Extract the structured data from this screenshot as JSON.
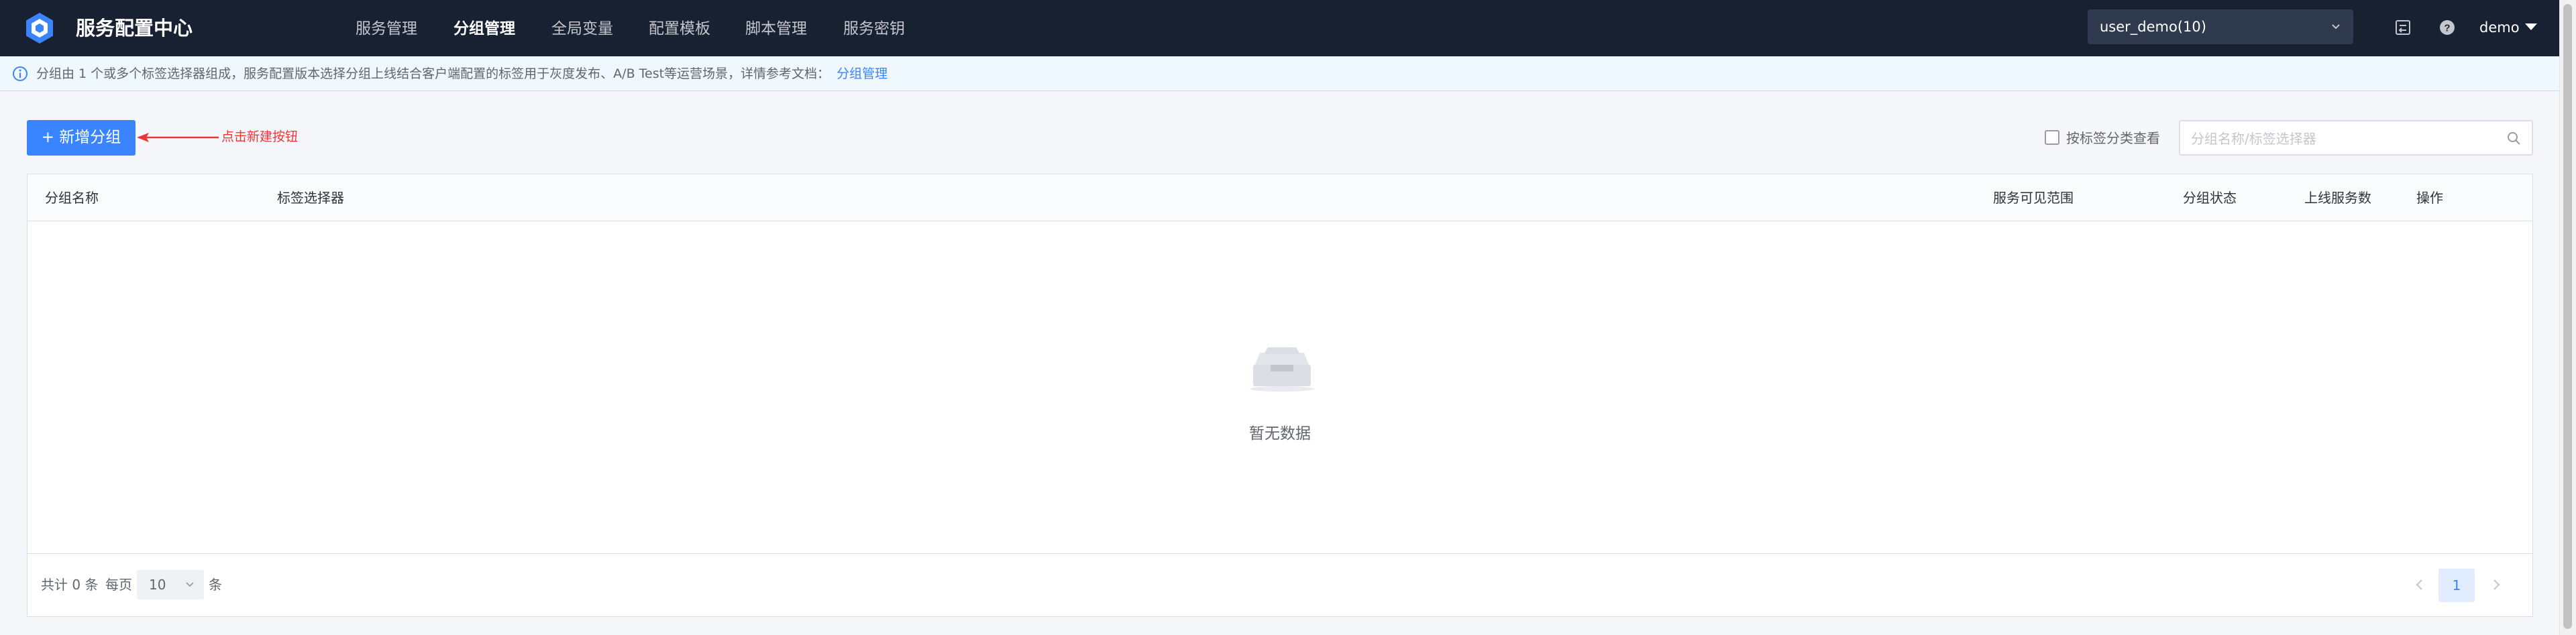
{
  "app": {
    "title": "服务配置中心"
  },
  "nav": {
    "items": [
      {
        "label": "服务管理",
        "active": false
      },
      {
        "label": "分组管理",
        "active": true
      },
      {
        "label": "全局变量",
        "active": false
      },
      {
        "label": "配置模板",
        "active": false
      },
      {
        "label": "脚本管理",
        "active": false
      },
      {
        "label": "服务密钥",
        "active": false
      }
    ]
  },
  "business_select": {
    "value": "user_demo(10)"
  },
  "user": {
    "name": "demo"
  },
  "icons": {
    "logo": "hexagon-logo-icon",
    "log": "log-icon",
    "help": "help-icon",
    "info": "info-icon",
    "search": "search-icon",
    "empty": "empty-box-icon"
  },
  "info_bar": {
    "message": "分组由 1 个或多个标签选择器组成，服务配置版本选择分组上线结合客户端配置的标签用于灰度发布、A/B Test等运营场景，详情参考文档：",
    "link": "分组管理"
  },
  "toolbar": {
    "add_button": "+ 新增分组",
    "annotation": "点击新建按钮",
    "checkbox_label": "按标签分类查看",
    "checkbox_checked": false,
    "search_placeholder": "分组名称/标签选择器"
  },
  "table": {
    "columns": [
      "分组名称",
      "标签选择器",
      "服务可见范围",
      "分组状态",
      "上线服务数",
      "操作"
    ],
    "rows": [],
    "empty_text": "暂无数据"
  },
  "pagination": {
    "total_label": "共计 0 条",
    "per_page_label": "每页",
    "page_size": "10",
    "unit_label": "条",
    "current_page": "1"
  },
  "colors": {
    "nav_bg": "#182132",
    "primary": "#3a84ff",
    "annotation": "#ea3636",
    "info_bg": "#f0f8ff"
  }
}
